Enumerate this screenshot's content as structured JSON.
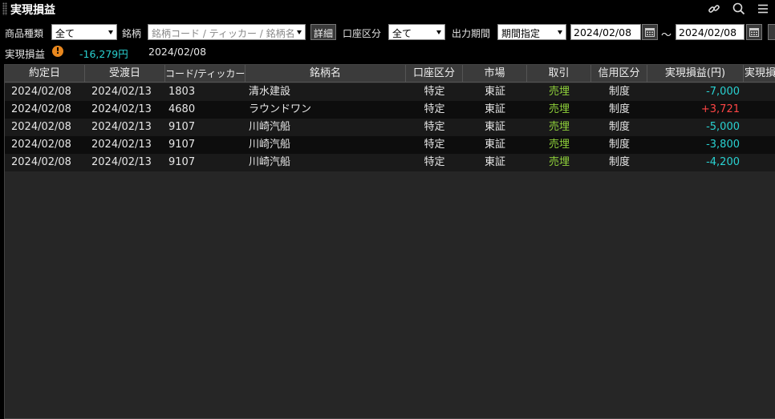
{
  "window": {
    "title": "実現損益"
  },
  "toolbar_icons": [
    "link-icon",
    "search-icon",
    "menu-icon"
  ],
  "filters": {
    "product_type_label": "商品種類",
    "product_type_value": "全て",
    "symbol_label": "銘柄",
    "symbol_placeholder": "銘柄コード / ティッカー / 銘柄名",
    "detail_button": "詳細",
    "account_label": "口座区分",
    "account_value": "全て",
    "period_label": "出力期間",
    "period_value": "期間指定",
    "date_from": "2024/02/08",
    "date_separator": "～",
    "date_to": "2024/02/08"
  },
  "summary": {
    "label": "実現損益",
    "value": "-16,279円",
    "date": "2024/02/08"
  },
  "table": {
    "headers": [
      "約定日",
      "受渡日",
      "コード/ティッカー",
      "銘柄名",
      "口座区分",
      "市場",
      "取引",
      "信用区分",
      "実現損益(円)",
      "実現損"
    ],
    "rows": [
      {
        "trade_date": "2024/02/08",
        "settle_date": "2024/02/13",
        "code": "1803",
        "name": "清水建設",
        "account": "特定",
        "market": "東証",
        "trade": "売埋",
        "margin": "制度",
        "pnl": "-7,000",
        "pnl_sign": "neg"
      },
      {
        "trade_date": "2024/02/08",
        "settle_date": "2024/02/13",
        "code": "4680",
        "name": "ラウンドワン",
        "account": "特定",
        "market": "東証",
        "trade": "売埋",
        "margin": "制度",
        "pnl": "+3,721",
        "pnl_sign": "pos"
      },
      {
        "trade_date": "2024/02/08",
        "settle_date": "2024/02/13",
        "code": "9107",
        "name": "川崎汽船",
        "account": "特定",
        "market": "東証",
        "trade": "売埋",
        "margin": "制度",
        "pnl": "-5,000",
        "pnl_sign": "neg"
      },
      {
        "trade_date": "2024/02/08",
        "settle_date": "2024/02/13",
        "code": "9107",
        "name": "川崎汽船",
        "account": "特定",
        "market": "東証",
        "trade": "売埋",
        "margin": "制度",
        "pnl": "-3,800",
        "pnl_sign": "neg"
      },
      {
        "trade_date": "2024/02/08",
        "settle_date": "2024/02/13",
        "code": "9107",
        "name": "川崎汽船",
        "account": "特定",
        "market": "東証",
        "trade": "売埋",
        "margin": "制度",
        "pnl": "-4,200",
        "pnl_sign": "neg"
      }
    ]
  },
  "colors": {
    "negative": "#29d2d2",
    "positive": "#ff4545",
    "trade_type": "#8fd13a",
    "warning": "#e8871e"
  }
}
